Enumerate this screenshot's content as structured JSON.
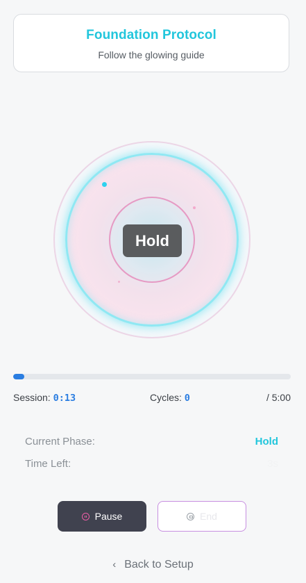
{
  "header": {
    "title": "Foundation Protocol",
    "subtitle": "Follow the glowing guide"
  },
  "orb": {
    "phase_label": "Hold"
  },
  "progress": {
    "fraction": 0.04
  },
  "stats": {
    "session_label": "Session:",
    "session_value": "0:13",
    "cycles_label": "Cycles:",
    "cycles_value": "0",
    "total": "/ 5:00"
  },
  "details": {
    "phase_label": "Current Phase:",
    "phase_value": "Hold",
    "time_label": "Time Left:",
    "time_value": "3s"
  },
  "buttons": {
    "pause_label": "Pause",
    "end_label": "End"
  },
  "footer": {
    "back_label": "Back to Setup"
  },
  "colors": {
    "accent_cyan": "#22c6dc",
    "progress_blue": "#2a7de1",
    "pause_pink": "#ef5ea8"
  },
  "icons": [
    "pause-icon",
    "stop-icon",
    "chevron-left-icon"
  ]
}
